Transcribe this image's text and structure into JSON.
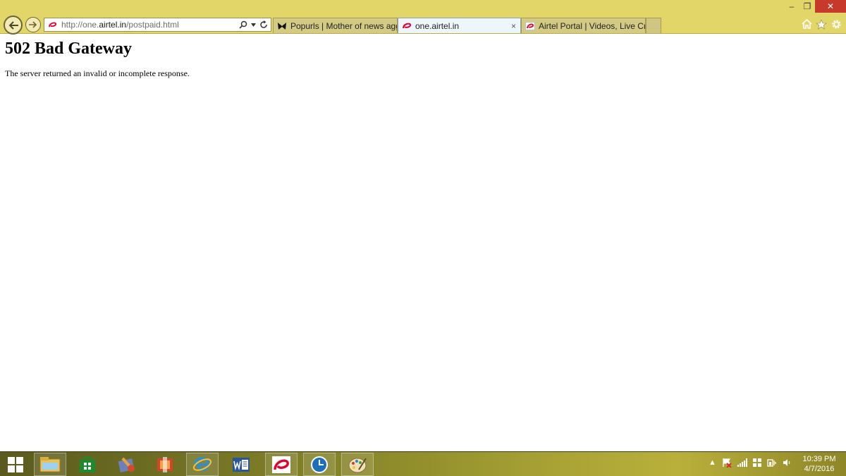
{
  "window": {
    "minimize_label": "–",
    "restore_label": "❐",
    "close_label": "✕"
  },
  "address_bar": {
    "url_prefix": "http://one.",
    "url_domain": "airtel.in",
    "url_path": "/postpaid.html"
  },
  "tabs": [
    {
      "title": "Popurls | Mother of news aggr...",
      "active": false
    },
    {
      "title": "one.airtel.in",
      "active": true,
      "close_label": "×"
    },
    {
      "title": "Airtel Portal | Videos, Live Crick...",
      "active": false
    }
  ],
  "page": {
    "title": "502 Bad Gateway",
    "message": "The server returned an invalid or incomplete response."
  },
  "taskbar": {
    "apps": [
      "start-icon",
      "file-explorer-icon",
      "store-icon",
      "media-player-icon",
      "office-icon",
      "internet-explorer-icon",
      "word-icon",
      "airtel-icon",
      "clock-app-icon",
      "paint-icon"
    ],
    "clock": {
      "time": "10:39 PM",
      "date": "4/7/2016"
    }
  },
  "colors": {
    "chrome": "#e3d668",
    "active_tab": "#eef6fd",
    "close_button": "#c7392b",
    "airtel_red": "#e4002b"
  }
}
